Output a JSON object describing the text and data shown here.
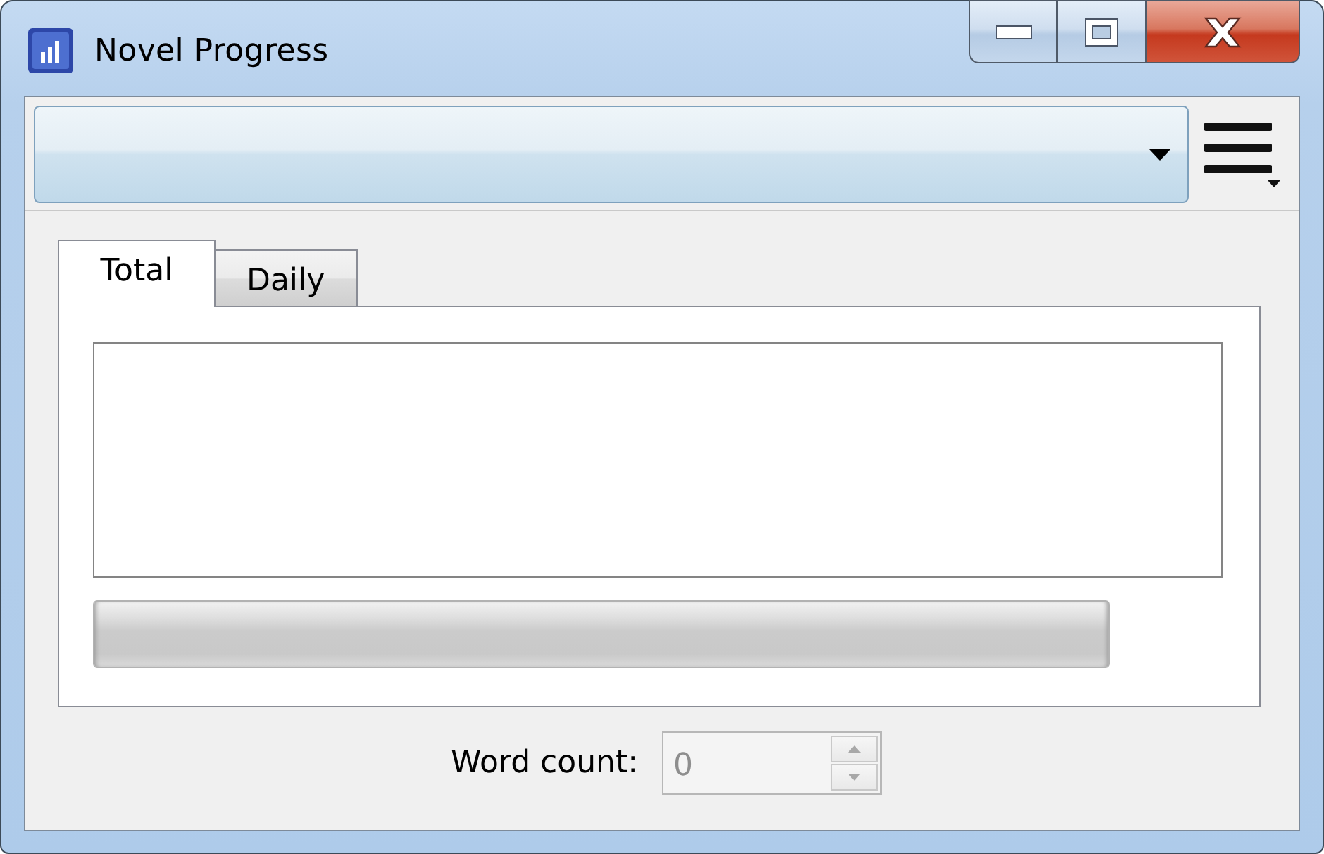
{
  "window": {
    "title": "Novel Progress"
  },
  "tabs": [
    {
      "label": "Total",
      "selected": true
    },
    {
      "label": "Daily",
      "selected": false
    }
  ],
  "word_count": {
    "label": "Word count:",
    "value": "0",
    "disabled": true
  }
}
